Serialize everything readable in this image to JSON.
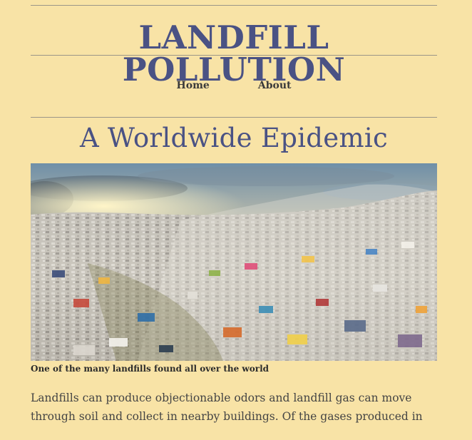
{
  "header": {
    "site_title": "LANDFILL POLLUTION"
  },
  "nav": {
    "items": [
      {
        "label": "Home"
      },
      {
        "label": "About"
      }
    ]
  },
  "main": {
    "heading": "A Worldwide Epidemic",
    "image_caption": "One of the many landfills found all over the world",
    "paragraph": "Landfills can produce objectionable odors and landfill gas can move through soil and collect in nearby buildings. Of the gases produced in"
  },
  "colors": {
    "background": "#f8e3a6",
    "title": "#4a5284",
    "rule": "#9b9688"
  }
}
